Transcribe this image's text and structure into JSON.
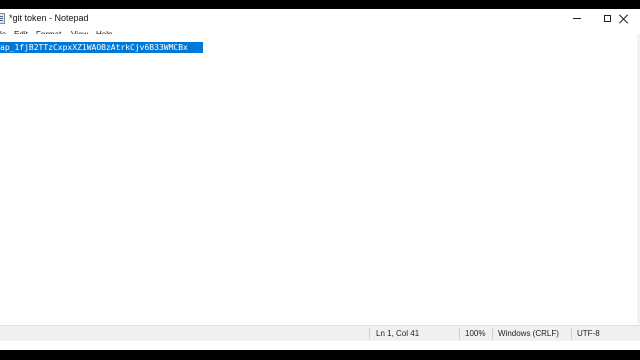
{
  "window": {
    "title": "*git token - Notepad"
  },
  "menu": {
    "items": [
      "le",
      "Edit",
      "Format",
      "View",
      "Help"
    ]
  },
  "editor": {
    "selected_text": "ap_1fjB2TTzCxpxXZ1WAOBzAtrkCjv6B33WMCBx"
  },
  "status": {
    "position": "Ln 1, Col 41",
    "zoom": "100%",
    "line_ending": "Windows (CRLF)",
    "encoding": "UTF-8"
  },
  "colors": {
    "selection": "#0078d7",
    "status_bar": "#f0f0f0"
  }
}
